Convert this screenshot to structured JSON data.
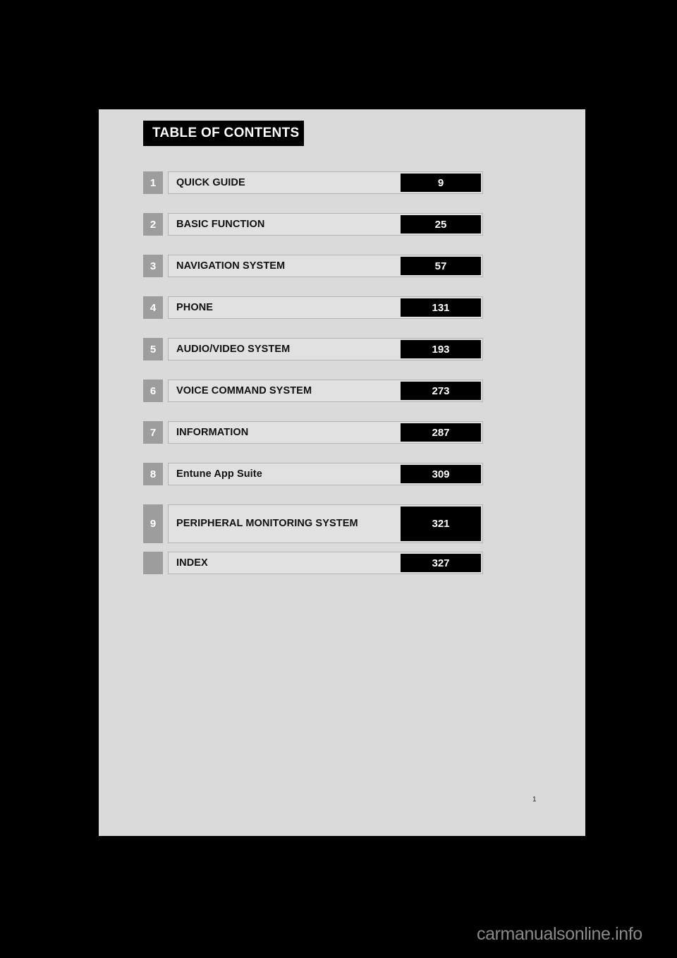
{
  "page": {
    "background_color": "#dadada",
    "folio": "1",
    "watermark": "carmanualsonline.info"
  },
  "toc": {
    "banner_title": "TABLE OF CONTENTS",
    "accent_colors": {
      "chip": "#9d9d9d",
      "title_bar": "#e1e1e1",
      "page_bar": "#000000"
    },
    "rows": [
      {
        "number": "1",
        "title": "QUICK GUIDE",
        "page": "9"
      },
      {
        "number": "2",
        "title": "BASIC FUNCTION",
        "page": "25"
      },
      {
        "number": "3",
        "title": "NAVIGATION SYSTEM",
        "page": "57"
      },
      {
        "number": "4",
        "title": "PHONE",
        "page": "131"
      },
      {
        "number": "5",
        "title": "AUDIO/VIDEO SYSTEM",
        "page": "193"
      },
      {
        "number": "6",
        "title": "VOICE COMMAND SYSTEM",
        "page": "273"
      },
      {
        "number": "7",
        "title": "INFORMATION",
        "page": "287"
      },
      {
        "number": "8",
        "title": "Entune App Suite",
        "page": "309"
      },
      {
        "number": "9",
        "title": "PERIPHERAL MONITORING SYSTEM",
        "page": "321"
      },
      {
        "number": "",
        "title": "INDEX",
        "page": "327"
      }
    ]
  }
}
